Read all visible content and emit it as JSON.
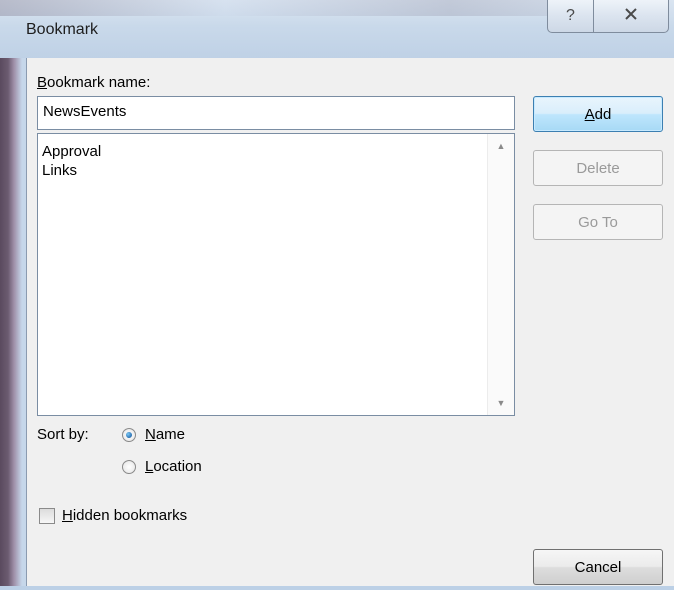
{
  "window": {
    "title": "Bookmark",
    "help_glyph": "?",
    "close_glyph": "X"
  },
  "form": {
    "name_label_prefix": "B",
    "name_label_rest": "ookmark name:",
    "name_value": "NewsEvents",
    "list_items": [
      "Approval",
      "Links"
    ],
    "sort_label": "Sort by:",
    "sort_options": [
      {
        "prefix": "",
        "underlined": "N",
        "rest": "ame",
        "selected": true
      },
      {
        "prefix": "",
        "underlined": "L",
        "rest": "ocation",
        "selected": false
      }
    ],
    "hidden_prefix": "",
    "hidden_underlined": "H",
    "hidden_rest": "idden bookmarks",
    "hidden_checked": false
  },
  "buttons": {
    "add_underlined": "A",
    "add_rest": "dd",
    "delete": "Delete",
    "goto": "Go To",
    "cancel": "Cancel"
  }
}
